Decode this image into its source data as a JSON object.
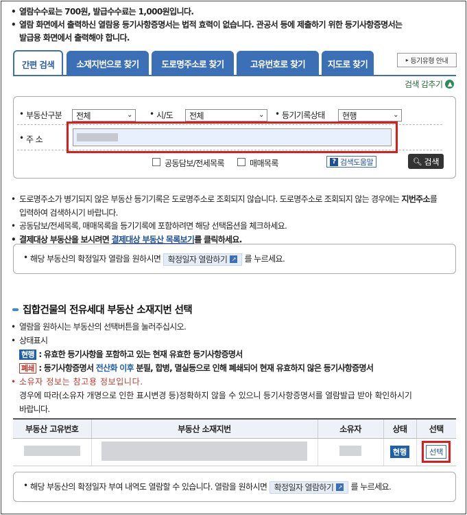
{
  "top_notes": [
    "열람수수료는 700원, 발급수수료는 1,000원입니다.",
    "열람 화면에서 출력하신 열람용 등기사항증명서는 법적 효력이 없습니다. 관공서 등에 제출하기 위한 등기사항증명서는",
    "발급용 화면에서 출력해야 합니다."
  ],
  "tabs": [
    {
      "label": "간편 검색",
      "active": true
    },
    {
      "label": "소재지번으로 찾기"
    },
    {
      "label": "도로명주소로 찾기"
    },
    {
      "label": "고유번호로 찾기"
    },
    {
      "label": "지도로 찾기"
    }
  ],
  "guide_button": "등기유형 안내",
  "collapse_label": "검색 감추기",
  "search": {
    "property_type_label": "부동산구분",
    "property_type_value": "전체",
    "region_label": "시/도",
    "region_value": "전체",
    "record_status_label": "등기기록상태",
    "record_status_value": "현행",
    "address_label": "주 소",
    "joint_collateral_label": "공동담보/전세목록",
    "sales_list_label": "매매목록",
    "help_label": "검색도움말",
    "search_label": "검색"
  },
  "notes": {
    "n1a": "도로명주소가 병기되지 않은 부동산 등기기록은 도로명주소로 조회되지 않습니다. 도로명주소로 조회되지 않는 경우에는 ",
    "n1b": "지번주소",
    "n1c": "를",
    "n1d": "입력하여 검색하시기 바랍니다.",
    "n2": "공동담보/전세목록, 매매목록을 등기기록에 포함하려면 해당 선택옵션을 체크하세요.",
    "n3a": "결제대상 부동산을 보시려면 ",
    "n3link": "결제대상 부동산 목록보기",
    "n3b": "를 클릭하세요."
  },
  "confirm_box": {
    "before": "해당 부동산의 확정일자 열람을 원하시면",
    "button": "확정일자 열람하기",
    "after": "를 누르세요."
  },
  "section_title": "집합건물의 전유세대 부동산 소재지번 선택",
  "section_notes": {
    "s1": "열람을 원하시는 부동산의 선택버튼을 눌러주십시오.",
    "s2": "상태표시",
    "current_badge": "현행",
    "current_desc": ": 유효한 등기사항을 포함하고 있는 현재 유효한 등기사항증명서",
    "closed_badge": "폐쇄",
    "closed_desc_a": ": 등기사항증명서 ",
    "closed_desc_blue": "전산화 이후",
    "closed_desc_b": " 분필, 합병, 멸실등으로 인해 폐쇄되어 현재 유효하지 않은 등기사항증명서",
    "owner_warn": "소유자 정보는 참고용 정보입니다.",
    "owner_desc1": "경우에 따라(소유자 개명으로 인한 표시변경 등)정확하지 않을 수 있으니 등기사항증명서를 열람발급 받아 확인하시기",
    "owner_desc2": "바랍니다."
  },
  "table": {
    "headers": [
      "부동산 고유번호",
      "부동산 소재지번",
      "소유자",
      "상태",
      "선택"
    ],
    "row": {
      "status": "현행",
      "select": "선택"
    }
  },
  "confirm_box2": {
    "before": "해당 부동산의 확정일자 부여 내역도 열람할 수 있습니다. 열람을 원하시면",
    "button": "확정일자 열람하기",
    "after": "를 누르세요."
  }
}
